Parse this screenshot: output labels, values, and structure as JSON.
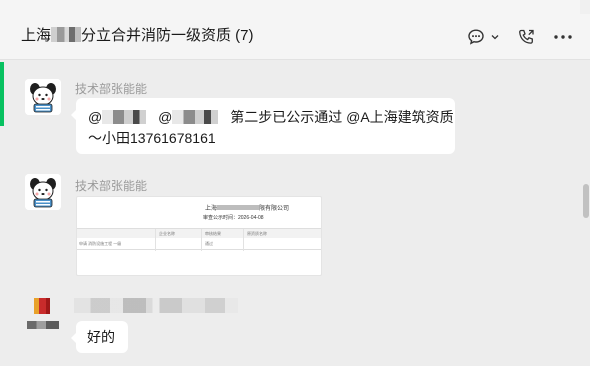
{
  "header": {
    "title_prefix": "上海",
    "title_suffix": "分立合并消防一级资质 (7)",
    "icons": [
      "chat-bubble-icon",
      "chevron-down-icon",
      "phone-icon",
      "more-icon"
    ]
  },
  "messages": [
    {
      "sender": "技术部张能能",
      "mention_1": "@",
      "mention_2": "@",
      "text_line1": "第二步已公示通过 @A上海建筑资质",
      "text_line2": "～小田13761678161"
    },
    {
      "sender": "技术部张能能",
      "doc": {
        "title_prefix": "上海",
        "title_suffix": "限有限公司",
        "subtitle": "审查公示时间：2026-04-08",
        "col1": "企业名称",
        "col2": "审核结果",
        "col3": "原资质名称",
        "row_item": "申请 消防设施工程 一级",
        "row_result": "通过"
      }
    },
    {
      "text": "好的"
    }
  ],
  "colors": {
    "accent": "#07c160",
    "background": "#ededed",
    "bubble": "#ffffff"
  }
}
